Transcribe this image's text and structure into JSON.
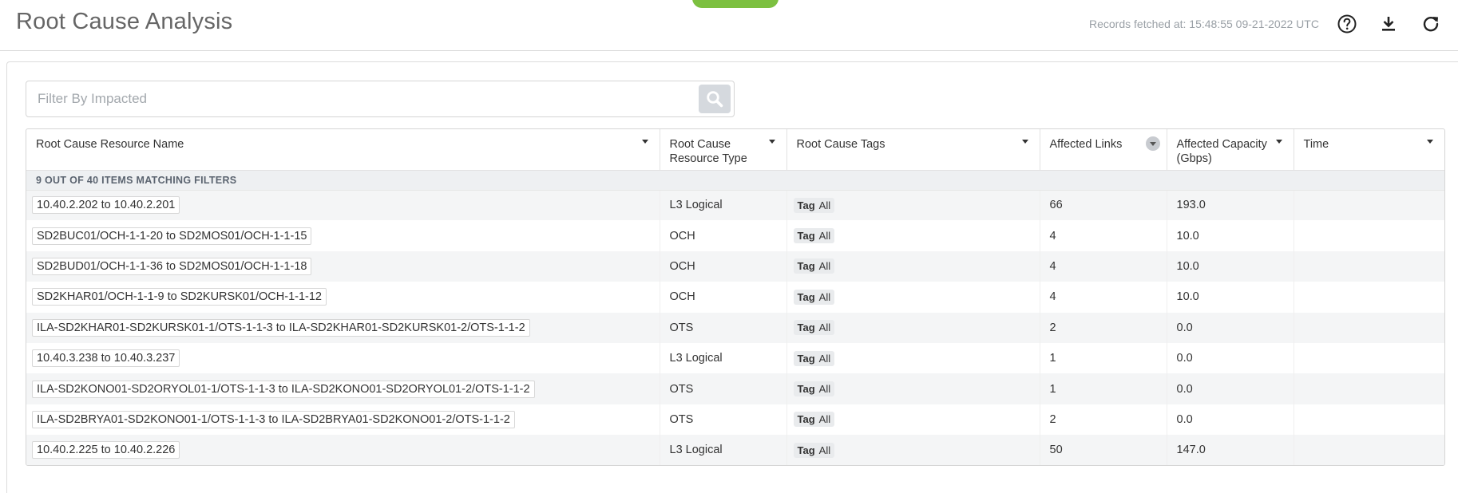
{
  "header": {
    "title": "Root Cause Analysis",
    "fetched_text": "Records fetched at: 15:48:55 09-21-2022 UTC",
    "icons": [
      "help-icon",
      "download-icon",
      "refresh-icon"
    ]
  },
  "filter": {
    "placeholder": "Filter By Impacted",
    "value": ""
  },
  "table": {
    "columns": [
      {
        "key": "name",
        "label": "Root Cause Resource Name"
      },
      {
        "key": "type",
        "label": "Root Cause Resource Type"
      },
      {
        "key": "tags",
        "label": "Root Cause Tags"
      },
      {
        "key": "links",
        "label": "Affected Links"
      },
      {
        "key": "capacity",
        "label": "Affected Capacity (Gbps)"
      },
      {
        "key": "time",
        "label": "Time"
      }
    ],
    "matching_text": "9 OUT OF 40 ITEMS MATCHING FILTERS",
    "tag_label": "Tag",
    "tag_value": "All",
    "rows": [
      {
        "name": "10.40.2.202 to 10.40.2.201",
        "type": "L3 Logical",
        "links": "66",
        "capacity": "193.0",
        "time": ""
      },
      {
        "name": "SD2BUC01/OCH-1-1-20 to SD2MOS01/OCH-1-1-15",
        "type": "OCH",
        "links": "4",
        "capacity": "10.0",
        "time": ""
      },
      {
        "name": "SD2BUD01/OCH-1-1-36 to SD2MOS01/OCH-1-1-18",
        "type": "OCH",
        "links": "4",
        "capacity": "10.0",
        "time": ""
      },
      {
        "name": "SD2KHAR01/OCH-1-1-9 to SD2KURSK01/OCH-1-1-12",
        "type": "OCH",
        "links": "4",
        "capacity": "10.0",
        "time": ""
      },
      {
        "name": "ILA-SD2KHAR01-SD2KURSK01-1/OTS-1-1-3 to ILA-SD2KHAR01-SD2KURSK01-2/OTS-1-1-2",
        "type": "OTS",
        "links": "2",
        "capacity": "0.0",
        "time": ""
      },
      {
        "name": "10.40.3.238 to 10.40.3.237",
        "type": "L3 Logical",
        "links": "1",
        "capacity": "0.0",
        "time": ""
      },
      {
        "name": "ILA-SD2KONO01-SD2ORYOL01-1/OTS-1-1-3 to ILA-SD2KONO01-SD2ORYOL01-2/OTS-1-1-2",
        "type": "OTS",
        "links": "1",
        "capacity": "0.0",
        "time": ""
      },
      {
        "name": "ILA-SD2BRYA01-SD2KONO01-1/OTS-1-1-3 to ILA-SD2BRYA01-SD2KONO01-2/OTS-1-1-2",
        "type": "OTS",
        "links": "2",
        "capacity": "0.0",
        "time": ""
      },
      {
        "name": "10.40.2.225 to 10.40.2.226",
        "type": "L3 Logical",
        "links": "50",
        "capacity": "147.0",
        "time": ""
      }
    ]
  }
}
